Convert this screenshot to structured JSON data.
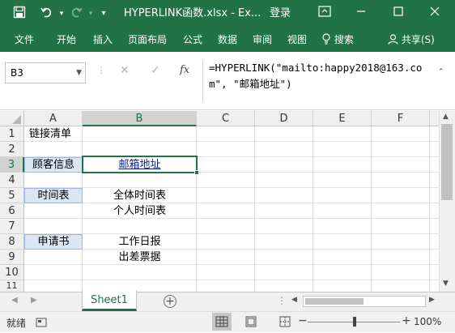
{
  "titlebar": {
    "filename": "HYPERLINK函数.xlsx  -  Ex...",
    "login": "登录",
    "save_icon": "save-icon",
    "undo_icon": "undo-icon",
    "redo_icon": "redo-icon",
    "customize_icon": "customize-qat-icon",
    "ribbon_display_icon": "ribbon-display-icon",
    "min_icon": "minimize-icon",
    "max_icon": "maximize-icon",
    "close_icon": "close-icon",
    "bg_color": "#217346"
  },
  "ribbon": {
    "tabs": [
      "文件",
      "开始",
      "插入",
      "页面布局",
      "公式",
      "数据",
      "审阅",
      "视图"
    ],
    "search_label": "搜索",
    "share_label": "共享(S)"
  },
  "formula_bar": {
    "name_box": "B3",
    "formula": "=HYPERLINK(\"mailto:happy2018@163.com\", \"邮箱地址\")",
    "fx": "fx",
    "cancel": "✕",
    "enter": "✓"
  },
  "grid": {
    "columns": [
      "A",
      "B",
      "C",
      "D",
      "E",
      "F"
    ],
    "rows": [
      "1",
      "2",
      "3",
      "4",
      "5",
      "6",
      "7",
      "8",
      "9",
      "10",
      "11"
    ],
    "cells": {
      "A1": "链接清单",
      "A3": "顾客信息",
      "B3": "邮箱地址",
      "A5": "时间表",
      "B5": "全体时间表",
      "B6": "个人时间表",
      "A8": "申请书",
      "B8": "工作日报",
      "B9": "出差票据"
    },
    "selected": "B3"
  },
  "sheets": {
    "tabs": [
      "Sheet1"
    ],
    "active": "Sheet1"
  },
  "statusbar": {
    "mode": "就绪",
    "zoom": "100%"
  }
}
